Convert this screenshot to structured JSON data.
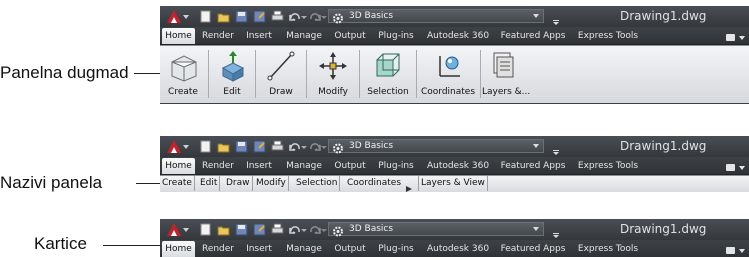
{
  "callouts": {
    "panel_buttons": "Panelna dugmad",
    "panel_names": "Nazivi panela",
    "tabs": "Kartice"
  },
  "app": {
    "workspace": "3D Basics",
    "title": "Drawing1.dwg"
  },
  "tabs": [
    "Home",
    "Render",
    "Insert",
    "Manage",
    "Output",
    "Plug-ins",
    "Autodesk 360",
    "Featured Apps",
    "Express Tools"
  ],
  "panel_buttons": [
    "Create",
    "Edit",
    "Draw",
    "Modify",
    "Selection",
    "Coordinates",
    "Layers &..."
  ],
  "panel_titles": [
    "Create",
    "Edit",
    "Draw",
    "Modify",
    "Selection",
    "Coordinates",
    "Layers & View"
  ],
  "icons": {
    "app_menu": "autocad-logo-icon",
    "quick_access": [
      "new-icon",
      "open-icon",
      "save-icon",
      "save-as-icon",
      "plot-icon",
      "undo-icon",
      "undo-dropdown-icon",
      "redo-icon",
      "redo-dropdown-icon"
    ],
    "workspace": "gear-icon",
    "panel_buttons": [
      "box-icon",
      "extrude-icon",
      "line-icon",
      "move-icon",
      "selection-cube-icon",
      "ucs-icon",
      "layers-icon"
    ]
  },
  "colors": {
    "ribbon_dark": "#3b3f44",
    "ribbon_light": "#e6e8eb",
    "app_red": "#c8202a"
  }
}
